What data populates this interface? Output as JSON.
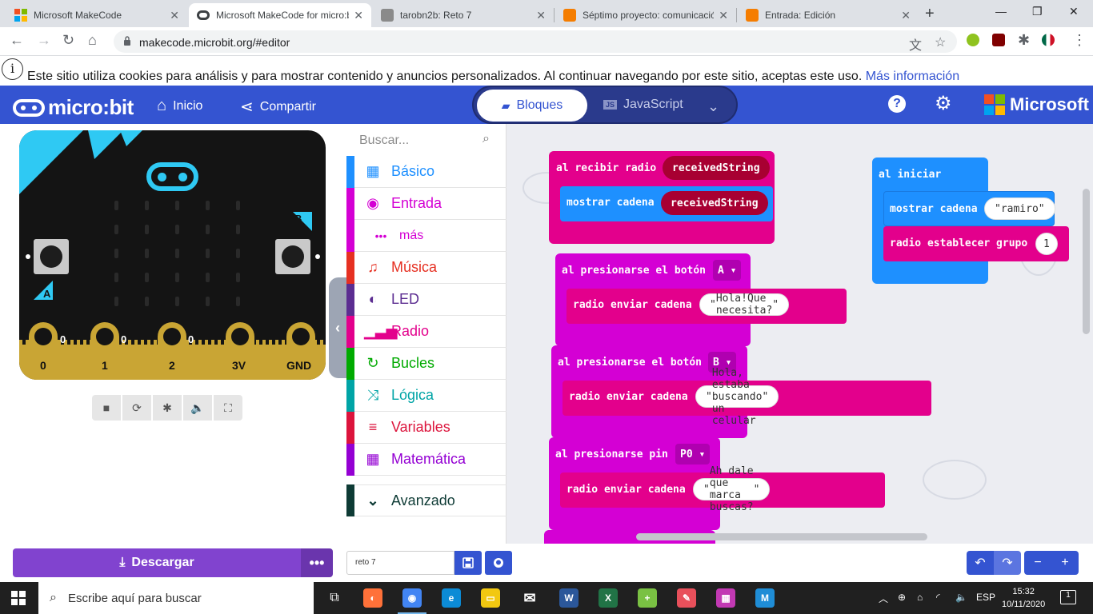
{
  "browser": {
    "tabs": [
      {
        "title": "Microsoft MakeCode",
        "favicon_color": "#f25022"
      },
      {
        "title": "Microsoft MakeCode for micro:bit",
        "favicon_color": "#3c4043"
      },
      {
        "title": "tarobn2b: Reto 7",
        "favicon_color": "#8a8a8a"
      },
      {
        "title": "Séptimo proyecto: comunicación",
        "favicon_color": "#f57d00"
      },
      {
        "title": "Entrada: Edición",
        "favicon_color": "#f57d00"
      }
    ],
    "close_glyph": "✕",
    "new_tab_glyph": "+",
    "minimize_glyph": "—",
    "maximize_glyph": "❐",
    "window_close_glyph": "✕",
    "url": "makecode.microbit.org/#editor",
    "back_icon": "←",
    "forward_icon": "→",
    "reload_icon": "↻",
    "home_icon": "⌂",
    "translate_icon": "文",
    "star_icon": "☆",
    "puzzle_icon": "✱",
    "menu_icon": "⋮"
  },
  "cookie": {
    "info_glyph": "i",
    "message": "Este sitio utiliza cookies para análisis y para mostrar contenido y anuncios personalizados. Al continuar navegando por este sitio, aceptas este uso.",
    "link": "Más información"
  },
  "header": {
    "logo_text": "micro:bit",
    "home_label": "Inicio",
    "home_icon": "⌂",
    "share_label": "Compartir",
    "share_icon": "⋖",
    "blocks_label": "Bloques",
    "blocks_icon": "▰",
    "js_label": "JavaScript",
    "js_badge": "JS",
    "chevron": "⌄",
    "help_icon": "?",
    "settings_icon": "⚙",
    "ms_label": "Microsoft",
    "colors": {
      "bar": "#3454d1",
      "red": "#f25022",
      "green": "#7fba00",
      "blue": "#00a4ef",
      "yellow": "#ffb900"
    }
  },
  "simulator": {
    "pins": [
      "0",
      "1",
      "2",
      "3V",
      "GND"
    ],
    "small_pin_labels": [
      "0",
      "0",
      "0"
    ],
    "button_a": "A",
    "button_b": "B",
    "controls": [
      "■",
      "⟳",
      "✱",
      "🔈",
      "⛶"
    ],
    "collapse_icon": "‹"
  },
  "toolbox": {
    "search_placeholder": "Buscar...",
    "search_icon": "⌕",
    "categories": [
      {
        "label": "Básico",
        "color": "#1e90ff",
        "icon": "▦"
      },
      {
        "label": "Entrada",
        "color": "#d400d4",
        "icon": "◉"
      },
      {
        "label": "más",
        "color": "#d400d4",
        "icon": "•••"
      },
      {
        "label": "Música",
        "color": "#e63022",
        "icon": "♫"
      },
      {
        "label": "LED",
        "color": "#5c2d91",
        "icon": "◐"
      },
      {
        "label": "Radio",
        "color": "#e3008c",
        "icon": "▁▃▅"
      },
      {
        "label": "Bucles",
        "color": "#00aa00",
        "icon": "↻"
      },
      {
        "label": "Lógica",
        "color": "#00a4a6",
        "icon": "⤨"
      },
      {
        "label": "Variables",
        "color": "#dc143c",
        "icon": "≡"
      },
      {
        "label": "Matemática",
        "color": "#9400d3",
        "icon": "▦"
      }
    ],
    "advanced": {
      "label": "Avanzado",
      "color": "#0e3b35",
      "icon": "⌄"
    }
  },
  "blocks": {
    "radio_received": {
      "label": "al recibir radio",
      "var": "receivedString",
      "inner_label": "mostrar cadena",
      "inner_var": "receivedString"
    },
    "on_start": {
      "label": "al iniciar",
      "show_label": "mostrar cadena",
      "show_value": "ramiro",
      "group_label": "radio establecer grupo",
      "group_value": "1"
    },
    "button_a": {
      "label": "al presionarse el botón",
      "dropdown": "A",
      "inner_label": "radio enviar cadena",
      "inner_value": "Hola!Que necesita?"
    },
    "button_b": {
      "label": "al presionarse el botón",
      "dropdown": "B",
      "inner_label": "radio enviar cadena",
      "inner_value": "Hola, estaba buscando un celular"
    },
    "pin_p0": {
      "label": "al presionarse pin",
      "dropdown": "P0",
      "inner_label": "radio enviar cadena",
      "inner_value": "Ah dale que marca buscas?"
    },
    "colors": {
      "radio": "#e3008c",
      "basic": "#1e90ff",
      "input": "#d400d4",
      "var": "#a80032"
    }
  },
  "bottom": {
    "download_label": "Descargar",
    "download_icon": "⤓",
    "more_label": "•••",
    "project_name": "reto 7",
    "save_icon": "💾",
    "github_icon": "◎",
    "undo_icon": "↶",
    "redo_icon": "↷",
    "zoom_out_icon": "−",
    "zoom_in_icon": "+"
  },
  "taskbar": {
    "search_placeholder": "Escribe aquí para buscar",
    "search_icon": "⌕",
    "task_view_icon": "⧉",
    "apps": [
      {
        "name": "firefox",
        "color": "#ff7139",
        "glyph": "◐"
      },
      {
        "name": "chrome",
        "color": "#4285f4",
        "glyph": "◉"
      },
      {
        "name": "edge",
        "color": "#0c8bd6",
        "glyph": "e"
      },
      {
        "name": "explorer",
        "color": "#f2c811",
        "glyph": "▭"
      },
      {
        "name": "mail",
        "color": "#ffffff",
        "glyph": "✉"
      },
      {
        "name": "word",
        "color": "#2b579a",
        "glyph": "W"
      },
      {
        "name": "excel",
        "color": "#217346",
        "glyph": "X"
      },
      {
        "name": "app-green",
        "color": "#7ac143",
        "glyph": "+"
      },
      {
        "name": "app-paint",
        "color": "#e8505b",
        "glyph": "✎"
      },
      {
        "name": "app-cube",
        "color": "#c239b3",
        "glyph": "▦"
      },
      {
        "name": "app-m",
        "color": "#1f8dd6",
        "glyph": "M"
      }
    ],
    "tray_chevron": "︿",
    "tray_icons": [
      "⊕",
      "⌂",
      "◜",
      "🔈"
    ],
    "language": "ESP",
    "time": "15:32",
    "date": "10/11/2020",
    "notification_count": "1"
  }
}
